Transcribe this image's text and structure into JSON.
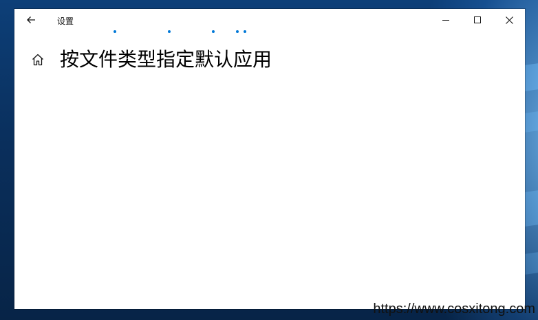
{
  "window": {
    "title": "设置",
    "page_title": "按文件类型指定默认应用"
  },
  "icons": {
    "back": "back-arrow-icon",
    "home": "home-icon",
    "minimize": "minimize-icon",
    "maximize": "maximize-icon",
    "close": "close-icon"
  },
  "colors": {
    "accent": "#0078d7",
    "window_bg": "#ffffff",
    "text": "#000000"
  },
  "watermark": {
    "text": "https://www.cosxitong.com"
  }
}
